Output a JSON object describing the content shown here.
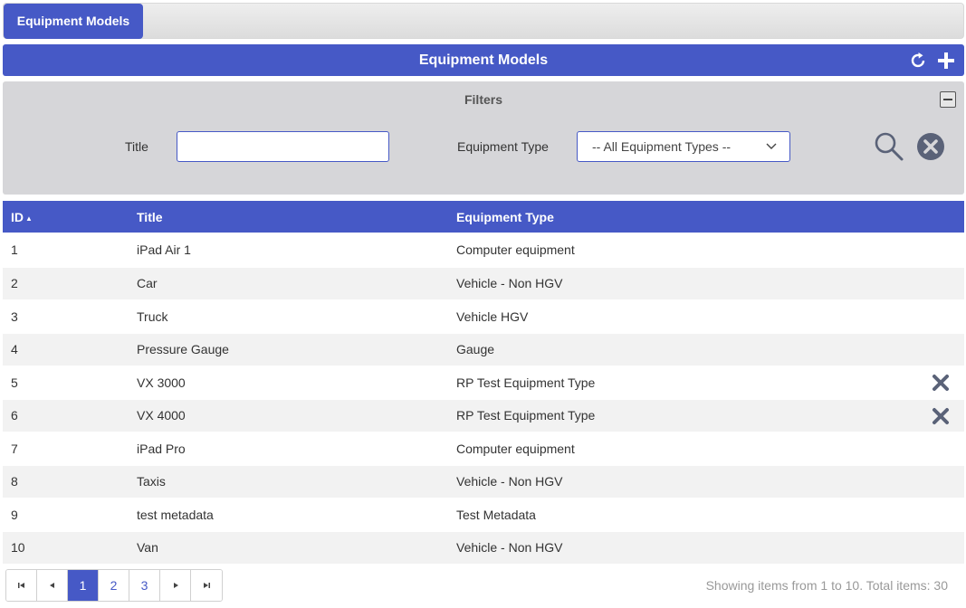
{
  "tabbar": {
    "tab_label": "Equipment Models"
  },
  "header": {
    "title": "Equipment Models",
    "refresh_icon": "refresh-icon",
    "add_icon": "plus-icon"
  },
  "filters": {
    "title": "Filters",
    "title_label": "Title",
    "title_value": "",
    "type_label": "Equipment Type",
    "type_selected": "-- All Equipment Types --",
    "search_icon": "search-icon",
    "clear_icon": "clear-icon"
  },
  "grid": {
    "columns": {
      "id": "ID",
      "title": "Title",
      "type": "Equipment Type"
    },
    "sort": {
      "column": "ID",
      "direction": "ascending"
    },
    "rows": [
      {
        "id": "1",
        "title": "iPad Air 1",
        "type": "Computer equipment",
        "deletable": false
      },
      {
        "id": "2",
        "title": "Car",
        "type": "Vehicle - Non HGV",
        "deletable": false
      },
      {
        "id": "3",
        "title": "Truck",
        "type": "Vehicle HGV",
        "deletable": false
      },
      {
        "id": "4",
        "title": "Pressure Gauge",
        "type": "Gauge",
        "deletable": false
      },
      {
        "id": "5",
        "title": "VX 3000",
        "type": "RP Test Equipment Type",
        "deletable": true
      },
      {
        "id": "6",
        "title": "VX 4000",
        "type": "RP Test Equipment Type",
        "deletable": true
      },
      {
        "id": "7",
        "title": "iPad Pro",
        "type": "Computer equipment",
        "deletable": false
      },
      {
        "id": "8",
        "title": "Taxis",
        "type": "Vehicle - Non HGV",
        "deletable": false
      },
      {
        "id": "9",
        "title": "test metadata",
        "type": "Test Metadata",
        "deletable": false
      },
      {
        "id": "10",
        "title": "Van",
        "type": "Vehicle - Non HGV",
        "deletable": false
      }
    ]
  },
  "pager": {
    "pages": [
      "1",
      "2",
      "3"
    ],
    "current_page": "1",
    "summary": "Showing items from 1 to 10. Total items: 30"
  },
  "colors": {
    "accent": "#4659c6",
    "icon_gray": "#5a6278",
    "filter_bg": "#d6d6d9",
    "alt_row": "#f2f2f2"
  }
}
